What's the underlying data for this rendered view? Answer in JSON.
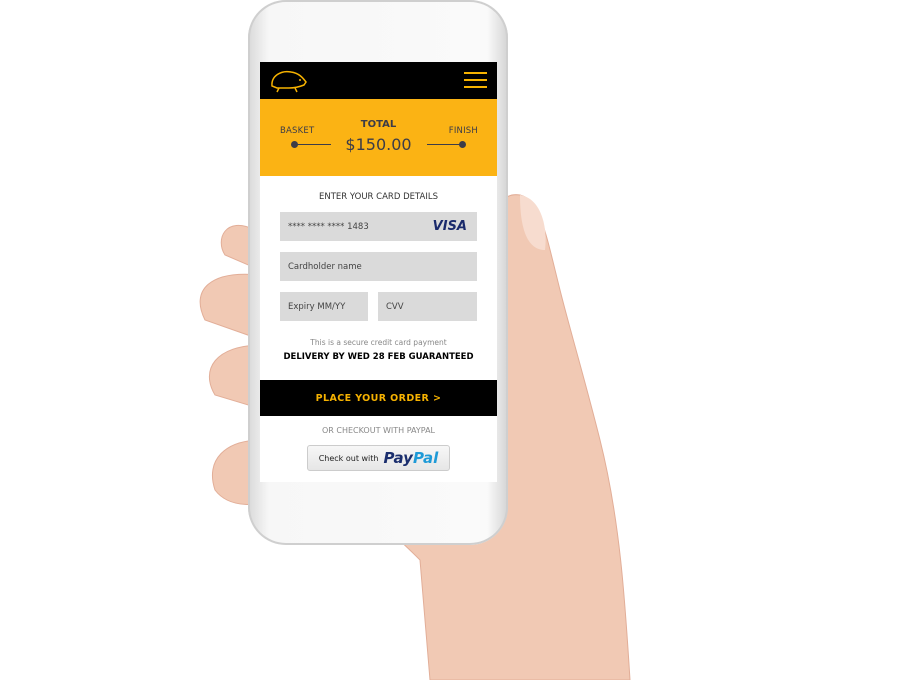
{
  "colors": {
    "accent": "#fbb314",
    "header": "#000000",
    "field": "#dadada",
    "skin": "#f1c9b4"
  },
  "header": {
    "logo_icon": "hedgehog-icon",
    "menu_icon": "hamburger-menu-icon"
  },
  "progress": {
    "step_left": "BASKET",
    "total_label": "TOTAL",
    "total_value": "$150.00",
    "step_right": "FINISH"
  },
  "card": {
    "title": "ENTER YOUR CARD DETAILS",
    "card_number": "**** **** **** 1483",
    "card_brand": "VISA",
    "cardholder_placeholder": "Cardholder name",
    "expiry_placeholder": "Expiry MM/YY",
    "cvv_placeholder": "CVV",
    "secure_note": "This is a secure credit card payment",
    "delivery": "DELIVERY BY WED 28 FEB GUARANTEED"
  },
  "order_button": "PLACE YOUR ORDER >",
  "paypal": {
    "divider": "OR CHECKOUT WITH PAYPAL",
    "button_text": "Check out with",
    "brand_pay": "Pay",
    "brand_pal": "Pal"
  }
}
